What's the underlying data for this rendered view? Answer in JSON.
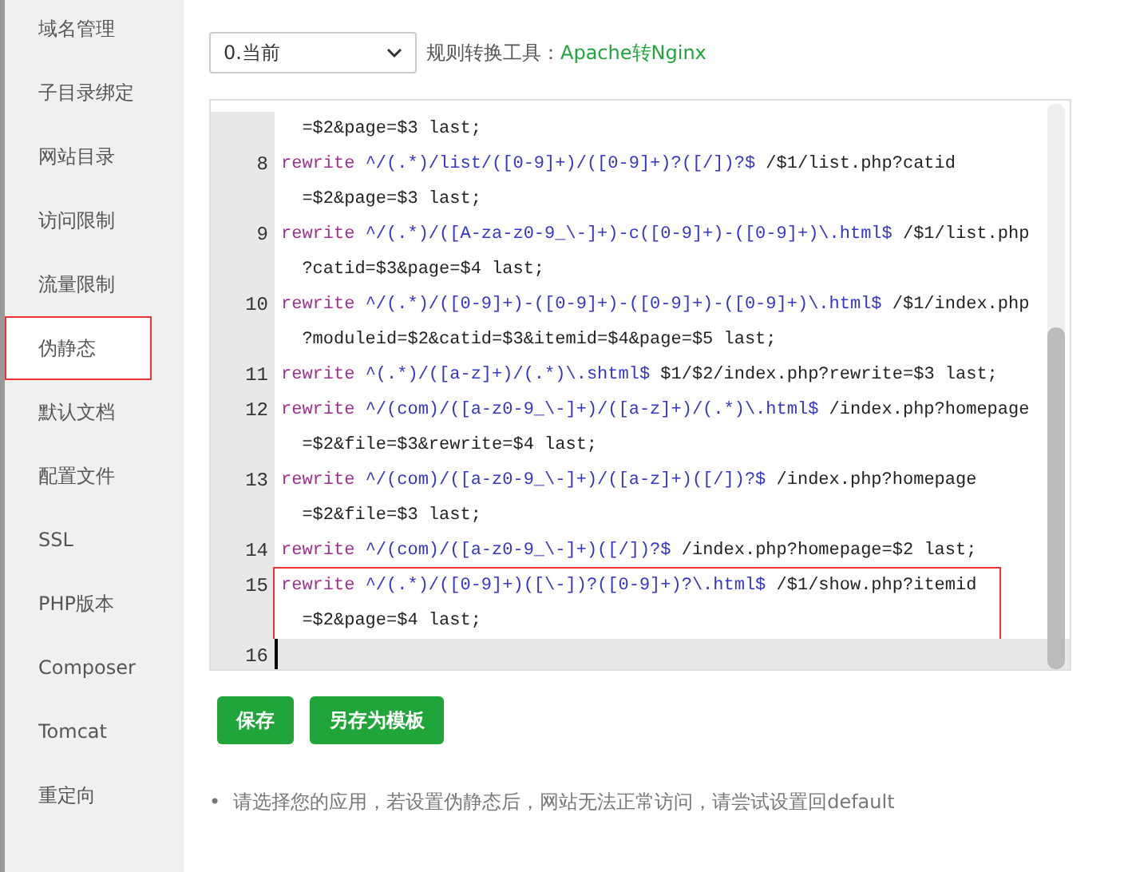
{
  "sidebar": {
    "items": [
      {
        "label": "域名管理",
        "selected": false
      },
      {
        "label": "子目录绑定",
        "selected": false
      },
      {
        "label": "网站目录",
        "selected": false
      },
      {
        "label": "访问限制",
        "selected": false
      },
      {
        "label": "流量限制",
        "selected": false
      },
      {
        "label": "伪静态",
        "selected": true
      },
      {
        "label": "默认文档",
        "selected": false
      },
      {
        "label": "配置文件",
        "selected": false
      },
      {
        "label": "SSL",
        "selected": false
      },
      {
        "label": "PHP版本",
        "selected": false
      },
      {
        "label": "Composer",
        "selected": false
      },
      {
        "label": "Tomcat",
        "selected": false
      },
      {
        "label": "重定向",
        "selected": false
      }
    ]
  },
  "toolbar": {
    "select": {
      "value": "0.当前"
    },
    "tool_label": "规则转换工具：",
    "tool_link": "Apache转Nginx"
  },
  "editor": {
    "lines": [
      {
        "highlighted": false,
        "rows": [
          [
            {
              "kind": "plain",
              "text": "  =$2&page=$3 last;"
            }
          ]
        ]
      },
      {
        "number": "8",
        "highlighted": false,
        "rows": [
          [
            {
              "kind": "keyword",
              "text": "rewrite"
            },
            {
              "kind": "regex",
              "text": " ^/(.*)/list/([0-9]+)/([0-9]+)?([/])?$"
            },
            {
              "kind": "plain",
              "text": " /$1/list.php?catid"
            }
          ],
          [
            {
              "kind": "plain",
              "text": "  =$2&page=$3 last;"
            }
          ]
        ]
      },
      {
        "number": "9",
        "highlighted": false,
        "rows": [
          [
            {
              "kind": "keyword",
              "text": "rewrite"
            },
            {
              "kind": "regex",
              "text": " ^/(.*)/([A-za-z0-9_\\-]+)-c([0-9]+)-([0-9]+)\\.html$"
            },
            {
              "kind": "plain",
              "text": " /$1/list.php"
            }
          ],
          [
            {
              "kind": "plain",
              "text": "  ?catid=$3&page=$4 last;"
            }
          ]
        ]
      },
      {
        "number": "10",
        "highlighted": false,
        "rows": [
          [
            {
              "kind": "keyword",
              "text": "rewrite"
            },
            {
              "kind": "regex",
              "text": " ^/(.*)/([0-9]+)-([0-9]+)-([0-9]+)-([0-9]+)\\.html$"
            },
            {
              "kind": "plain",
              "text": " /$1/index.php"
            }
          ],
          [
            {
              "kind": "plain",
              "text": "  ?moduleid=$2&catid=$3&itemid=$4&page=$5 last;"
            }
          ]
        ]
      },
      {
        "number": "11",
        "highlighted": false,
        "rows": [
          [
            {
              "kind": "keyword",
              "text": "rewrite"
            },
            {
              "kind": "regex",
              "text": " ^(.*)/([a-z]+)/(.*)\\.shtml$"
            },
            {
              "kind": "plain",
              "text": " $1/$2/index.php?rewrite=$3 last;"
            }
          ]
        ]
      },
      {
        "number": "12",
        "highlighted": false,
        "rows": [
          [
            {
              "kind": "keyword",
              "text": "rewrite"
            },
            {
              "kind": "regex",
              "text": " ^/(com)/([a-z0-9_\\-]+)/([a-z]+)/(.*)\\.html$"
            },
            {
              "kind": "plain",
              "text": " /index.php?homepage"
            }
          ],
          [
            {
              "kind": "plain",
              "text": "  =$2&file=$3&rewrite=$4 last;"
            }
          ]
        ]
      },
      {
        "number": "13",
        "highlighted": false,
        "rows": [
          [
            {
              "kind": "keyword",
              "text": "rewrite"
            },
            {
              "kind": "regex",
              "text": " ^/(com)/([a-z0-9_\\-]+)/([a-z]+)([/])?$"
            },
            {
              "kind": "plain",
              "text": " /index.php?homepage"
            }
          ],
          [
            {
              "kind": "plain",
              "text": "  =$2&file=$3 last;"
            }
          ]
        ]
      },
      {
        "number": "14",
        "highlighted": false,
        "rows": [
          [
            {
              "kind": "keyword",
              "text": "rewrite"
            },
            {
              "kind": "regex",
              "text": " ^/(com)/([a-z0-9_\\-]+)([/])?$"
            },
            {
              "kind": "plain",
              "text": " /index.php?homepage=$2 last;"
            }
          ]
        ]
      },
      {
        "number": "15",
        "highlighted": true,
        "rows": [
          [
            {
              "kind": "keyword",
              "text": "rewrite"
            },
            {
              "kind": "regex",
              "text": " ^/(.*)/([0-9]+)([\\-])?([0-9]+)?\\.html$"
            },
            {
              "kind": "plain",
              "text": " /$1/show.php?itemid"
            }
          ],
          [
            {
              "kind": "plain",
              "text": "  =$2&page=$4 last;"
            }
          ]
        ]
      },
      {
        "number": "16",
        "highlighted": false,
        "active": true,
        "rows": [
          []
        ]
      }
    ]
  },
  "buttons": [
    {
      "label": "保存"
    },
    {
      "label": "另存为模板"
    }
  ],
  "hints": [
    {
      "bullet": "•",
      "text": "请选择您的应用，若设置伪静态后，网站无法正常访问，请尝试设置回default"
    }
  ]
}
